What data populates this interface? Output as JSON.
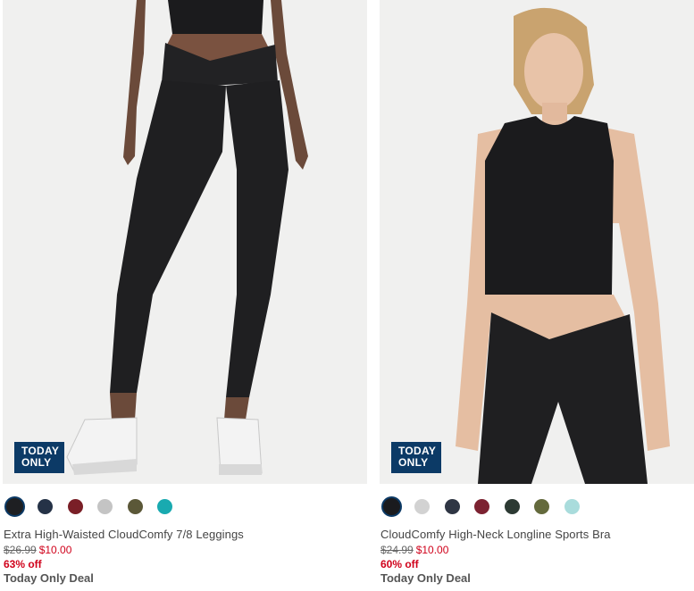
{
  "products": [
    {
      "badge": [
        "TODAY",
        "ONLY"
      ],
      "name": "Extra High-Waisted CloudComfy 7/8 Leggings",
      "original_price": "$26.99",
      "sale_price": "$10.00",
      "percent_off": "63% off",
      "deal_label": "Today Only Deal",
      "swatches": [
        "#1e1f22",
        "#253247",
        "#7a1f27",
        "#c4c4c4",
        "#5b5838",
        "#19aab0"
      ],
      "selected_swatch": 0
    },
    {
      "badge": [
        "TODAY",
        "ONLY"
      ],
      "name": "CloudComfy High-Neck Longline Sports Bra",
      "original_price": "$24.99",
      "sale_price": "$10.00",
      "percent_off": "60% off",
      "deal_label": "Today Only Deal",
      "swatches": [
        "#1a1b1e",
        "#d2d2d2",
        "#2f3644",
        "#7c2231",
        "#2c3a33",
        "#646a3d",
        "#a9dcdc"
      ],
      "selected_swatch": 0
    }
  ],
  "colors": {
    "badge_bg": "#0c3a66",
    "sale_red": "#d0021b"
  }
}
